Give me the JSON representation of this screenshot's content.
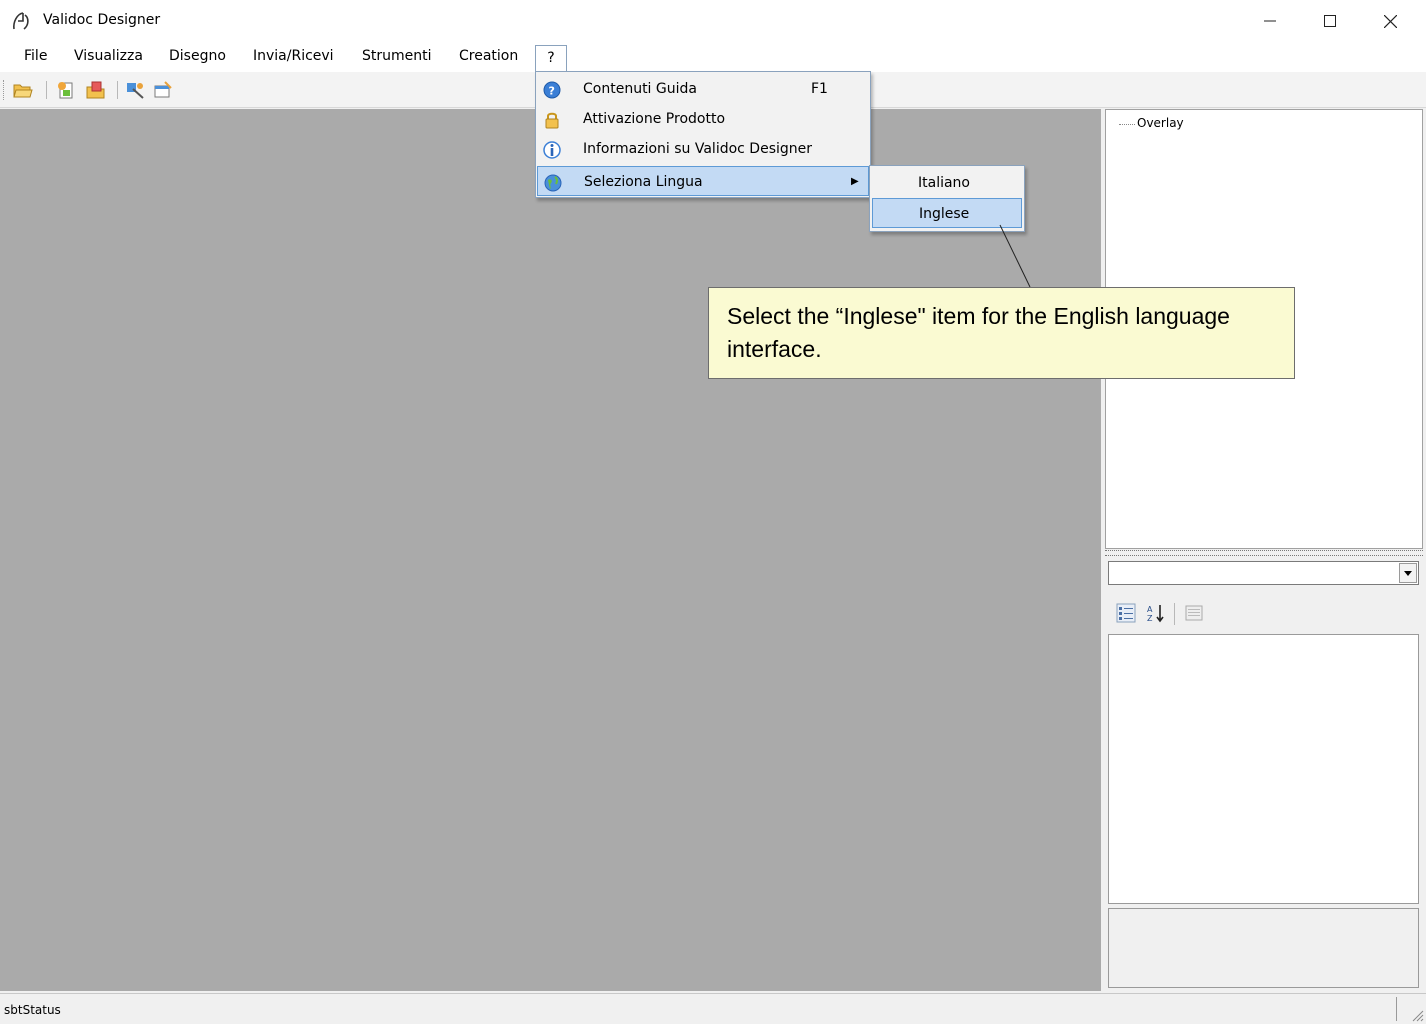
{
  "window": {
    "title": "Validoc Designer",
    "minimize_icon": "minimize-icon",
    "maximize_icon": "maximize-icon",
    "close_icon": "close-icon"
  },
  "menubar": {
    "items": [
      "File",
      "Visualizza",
      "Disegno",
      "Invia/Ricevi",
      "Strumenti",
      "Creation",
      "?"
    ]
  },
  "toolbar": {
    "icons": [
      "open-folder-icon",
      "new-document-icon",
      "open-document-icon",
      "tool-icon",
      "properties-icon"
    ]
  },
  "help_menu": {
    "items": [
      {
        "label": "Contenuti Guida",
        "shortcut": "F1",
        "icon": "help-icon"
      },
      {
        "label": "Attivazione Prodotto",
        "icon": "lock-icon"
      },
      {
        "label": "Informazioni su Validoc Designer",
        "icon": "info-icon"
      },
      {
        "label": "Seleziona Lingua",
        "icon": "globe-icon",
        "has_submenu": true
      }
    ]
  },
  "language_submenu": {
    "items": [
      "Italiano",
      "Inglese"
    ],
    "selected": "Inglese"
  },
  "tree": {
    "root": "Overlay"
  },
  "callout": {
    "text": "Select the “Inglese\" item for the English language interface."
  },
  "status": {
    "text": "sbtStatus"
  },
  "colors": {
    "canvas": "#aaaaaa",
    "highlight": "#c3daf4",
    "highlight_border": "#5e9ad6",
    "callout_bg": "#fafad2"
  }
}
